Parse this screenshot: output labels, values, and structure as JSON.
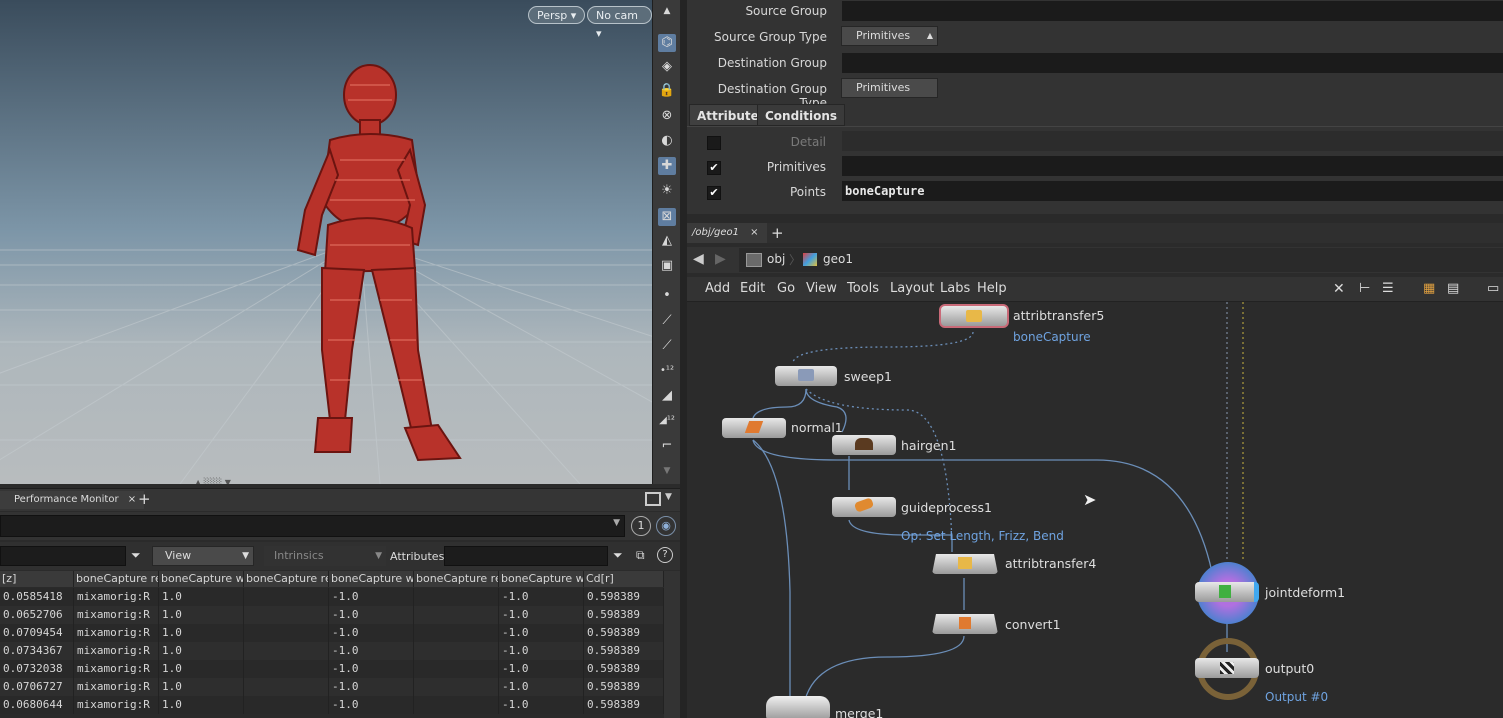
{
  "viewport": {
    "persp_label": "Persp",
    "cam_label": "No cam"
  },
  "pane": {
    "tab_label": "Performance Monitor",
    "tab_close": "×",
    "add": "+",
    "badge": "1"
  },
  "spreadsheet": {
    "view_label": "View",
    "intrinsics_label": "Intrinsics",
    "attributes_label": "Attributes:",
    "columns": [
      "[z]",
      "boneCapture re",
      "boneCapture w[",
      "boneCapture re",
      "boneCapture w[",
      "boneCapture re",
      "boneCapture w[",
      "Cd[r]"
    ],
    "rows": [
      [
        "0.0585418",
        "mixamorig:R",
        "1.0",
        "",
        "-1.0",
        "",
        "-1.0",
        "0.598389"
      ],
      [
        "0.0652706",
        "mixamorig:R",
        "1.0",
        "",
        "-1.0",
        "",
        "-1.0",
        "0.598389"
      ],
      [
        "0.0709454",
        "mixamorig:R",
        "1.0",
        "",
        "-1.0",
        "",
        "-1.0",
        "0.598389"
      ],
      [
        "0.0734367",
        "mixamorig:R",
        "1.0",
        "",
        "-1.0",
        "",
        "-1.0",
        "0.598389"
      ],
      [
        "0.0732038",
        "mixamorig:R",
        "1.0",
        "",
        "-1.0",
        "",
        "-1.0",
        "0.598389"
      ],
      [
        "0.0706727",
        "mixamorig:R",
        "1.0",
        "",
        "-1.0",
        "",
        "-1.0",
        "0.598389"
      ],
      [
        "0.0680644",
        "mixamorig:R",
        "1.0",
        "",
        "-1.0",
        "",
        "-1.0",
        "0.598389"
      ]
    ]
  },
  "params": {
    "source_group": "Source Group",
    "source_group_type": "Source Group Type",
    "source_group_type_value": "Primitives",
    "destination_group": "Destination Group",
    "destination_group_type": "Destination Group Type",
    "destination_group_type_value": "Primitives",
    "tabs": [
      "Attributes",
      "Conditions"
    ],
    "detail": "Detail",
    "primitives": "Primitives",
    "points": "Points",
    "points_value": "boneCapture"
  },
  "network": {
    "tab_label": "/obj/geo1",
    "tab_close": "×",
    "add": "+",
    "path": [
      "obj",
      "geo1"
    ],
    "menu": [
      "Add",
      "Edit",
      "Go",
      "View",
      "Tools",
      "Layout",
      "Labs",
      "Help"
    ],
    "nodes": {
      "attribtransfer5": "attribtransfer5",
      "attribtransfer5_sub": "boneCapture",
      "sweep1": "sweep1",
      "normal1": "normal1",
      "hairgen1": "hairgen1",
      "guideprocess1": "guideprocess1",
      "guideprocess1_sub": "Op: Set Length, Frizz, Bend",
      "attribtransfer4": "attribtransfer4",
      "convert1": "convert1",
      "jointdeform1": "jointdeform1",
      "output0": "output0",
      "output0_sub": "Output #0",
      "merge1": "merge1"
    }
  },
  "colors": {
    "accent": "#6fa3e0",
    "mesh": "#b8322a",
    "node_body": "#c9c9c9"
  }
}
